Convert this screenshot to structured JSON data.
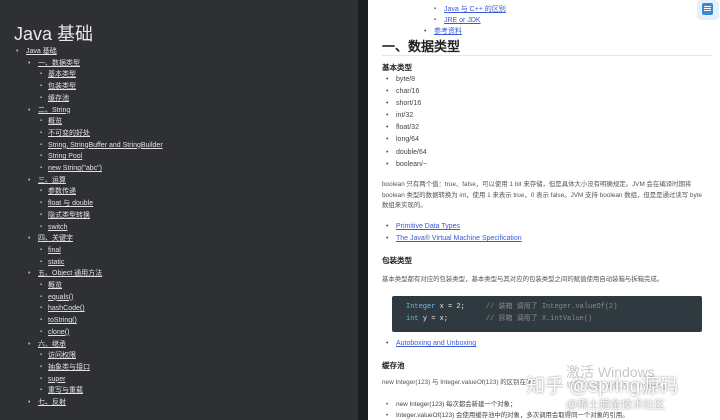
{
  "left_toc": {
    "title": "Java 基础",
    "items": [
      {
        "label": "Java 基础",
        "level": 0
      },
      {
        "label": "一、数据类型",
        "level": 1
      },
      {
        "label": "基本类型",
        "level": 2
      },
      {
        "label": "包装类型",
        "level": 2
      },
      {
        "label": "缓存池",
        "level": 2
      },
      {
        "label": "二、String",
        "level": 1
      },
      {
        "label": "概览",
        "level": 2
      },
      {
        "label": "不可变的好处",
        "level": 2
      },
      {
        "label": "String, StringBuffer and StringBuilder",
        "level": 2
      },
      {
        "label": "String Pool",
        "level": 2
      },
      {
        "label": "new String(\"abc\")",
        "level": 2
      },
      {
        "label": "三、运算",
        "level": 1
      },
      {
        "label": "参数传递",
        "level": 2
      },
      {
        "label": "float 与 double",
        "level": 2
      },
      {
        "label": "隐式类型转换",
        "level": 2
      },
      {
        "label": "switch",
        "level": 2
      },
      {
        "label": "四、关键字",
        "level": 1
      },
      {
        "label": "final",
        "level": 2
      },
      {
        "label": "static",
        "level": 2
      },
      {
        "label": "五、Object 通用方法",
        "level": 1
      },
      {
        "label": "概览",
        "level": 2
      },
      {
        "label": "equals()",
        "level": 2
      },
      {
        "label": "hashCode()",
        "level": 2
      },
      {
        "label": "toString()",
        "level": 2
      },
      {
        "label": "clone()",
        "level": 2
      },
      {
        "label": "六、继承",
        "level": 1
      },
      {
        "label": "访问权限",
        "level": 2
      },
      {
        "label": "抽象类与接口",
        "level": 2
      },
      {
        "label": "super",
        "level": 2
      },
      {
        "label": "重写与重载",
        "level": 2
      },
      {
        "label": "七、反射",
        "level": 1
      }
    ]
  },
  "right": {
    "top_links": [
      "Java 与 C++ 的区别",
      "JRE or JDK",
      "参考资料"
    ],
    "h1": "一、数据类型",
    "basic_heading": "基本类型",
    "basic_types": [
      "byte/8",
      "char/16",
      "short/16",
      "int/32",
      "float/32",
      "long/64",
      "double/64",
      "boolean/~"
    ],
    "boolean_para": "boolean 只有两个值：true、false，可以使用 1 bit 来存储，但是具体大小没有明确规定。JVM 会在编译时期将 boolean 类型的数据转换为 int，使用 1 来表示 true，0 表示 false。JVM 支持 boolean 数组，但是是通过读写 byte 数组来实现的。",
    "ref_links": [
      "Primitive Data Types",
      "The Java® Virtual Machine Specification"
    ],
    "wrapper_heading": "包装类型",
    "wrapper_para": "基本类型都有对应的包装类型，基本类型与其对应的包装类型之间的赋值使用自动装箱与拆箱完成。",
    "code": {
      "line1": {
        "type": "Integer",
        "var": "x = 2;",
        "comment": "// 装箱 调用了 Integer.valueOf(2)"
      },
      "line2": {
        "type": "int",
        "var": "y = x;",
        "comment": "// 拆箱 调用了 X.intValue()"
      }
    },
    "autobox_link": "Autoboxing and Unboxing",
    "cache_heading": "缓存池",
    "cache_para": "new Integer(123) 与 Integer.valueOf(123) 的区别在于：",
    "cache_items": [
      "new Integer(123) 每次都会新建一个对象；",
      "Integer.valueOf(123) 会使用缓存池中的对象，多次调用会取得同一个对象的引用。"
    ]
  },
  "watermarks": {
    "windows_line1": "激活 Windows",
    "windows_line2": "转到“设置”以激活 Windows。",
    "zhihu": "知乎 @spring源码",
    "juejin": "@稀土掘金技术社区"
  },
  "colors": {
    "left_bg": "#2e3033",
    "right_bg": "#ffffff",
    "link": "#3b5bd6",
    "code_bg": "#2f3a40"
  }
}
